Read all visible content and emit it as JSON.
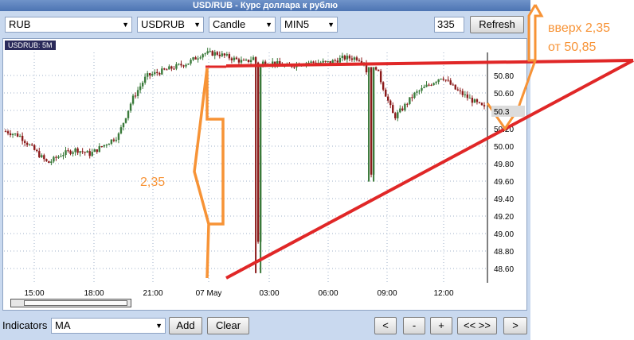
{
  "window": {
    "title": "USD/RUB - Курс доллара к рублю"
  },
  "toolbar": {
    "currency": "RUB",
    "pair": "USDRUB",
    "chart_type": "Candle",
    "interval": "MIN5",
    "bars": "335",
    "refresh_label": "Refresh"
  },
  "chart_tag": "USDRUB: 5M",
  "bottom": {
    "indicators_label": "Indicators",
    "indicator_value": "MA",
    "add_label": "Add",
    "clear_label": "Clear",
    "nav": [
      "<",
      "-",
      "+",
      "<< >>",
      ">"
    ]
  },
  "annotations": {
    "drop_label": "2,35",
    "up_label_1": "вверх 2,35",
    "up_label_2": "от 50,85"
  },
  "chart_data": {
    "type": "candlestick",
    "series_name": "USDRUB: 5M",
    "y_ticks": [
      "50.80",
      "50.60",
      "50.40",
      "50.20",
      "50.00",
      "49.80",
      "49.60",
      "49.40",
      "49.20",
      "49.00",
      "48.80",
      "48.60"
    ],
    "x_ticks": [
      "15:00",
      "18:00",
      "21:00",
      "07 May",
      "03:00",
      "06:00",
      "09:00",
      "12:00"
    ],
    "ylim": [
      48.5,
      51.1
    ],
    "last_price_label": "50.3",
    "price_path": [
      [
        0,
        50.1
      ],
      [
        5,
        50.05
      ],
      [
        10,
        49.9
      ],
      [
        15,
        49.75
      ],
      [
        20,
        49.85
      ],
      [
        25,
        49.9
      ],
      [
        30,
        49.85
      ],
      [
        35,
        49.95
      ],
      [
        40,
        50.05
      ],
      [
        45,
        50.45
      ],
      [
        50,
        50.7
      ],
      [
        55,
        50.75
      ],
      [
        60,
        50.8
      ],
      [
        65,
        50.85
      ],
      [
        70,
        50.95
      ],
      [
        75,
        50.95
      ],
      [
        80,
        50.9
      ],
      [
        85,
        50.85
      ],
      [
        88,
        50.9
      ],
      [
        90,
        48.55
      ],
      [
        91,
        50.85
      ],
      [
        95,
        50.85
      ],
      [
        100,
        50.8
      ],
      [
        105,
        50.85
      ],
      [
        110,
        50.85
      ],
      [
        115,
        50.85
      ],
      [
        120,
        50.9
      ],
      [
        125,
        50.9
      ],
      [
        128,
        50.85
      ],
      [
        130,
        49.55
      ],
      [
        131,
        50.85
      ],
      [
        135,
        50.5
      ],
      [
        138,
        50.25
      ],
      [
        141,
        50.35
      ],
      [
        145,
        50.5
      ],
      [
        150,
        50.6
      ],
      [
        155,
        50.7
      ],
      [
        160,
        50.55
      ],
      [
        165,
        50.45
      ],
      [
        170,
        50.35
      ]
    ]
  },
  "colors": {
    "accent_red": "#e02727",
    "accent_orange": "#f79336",
    "candle_up": "#3a7a3a",
    "candle_down": "#8b1a1a"
  }
}
